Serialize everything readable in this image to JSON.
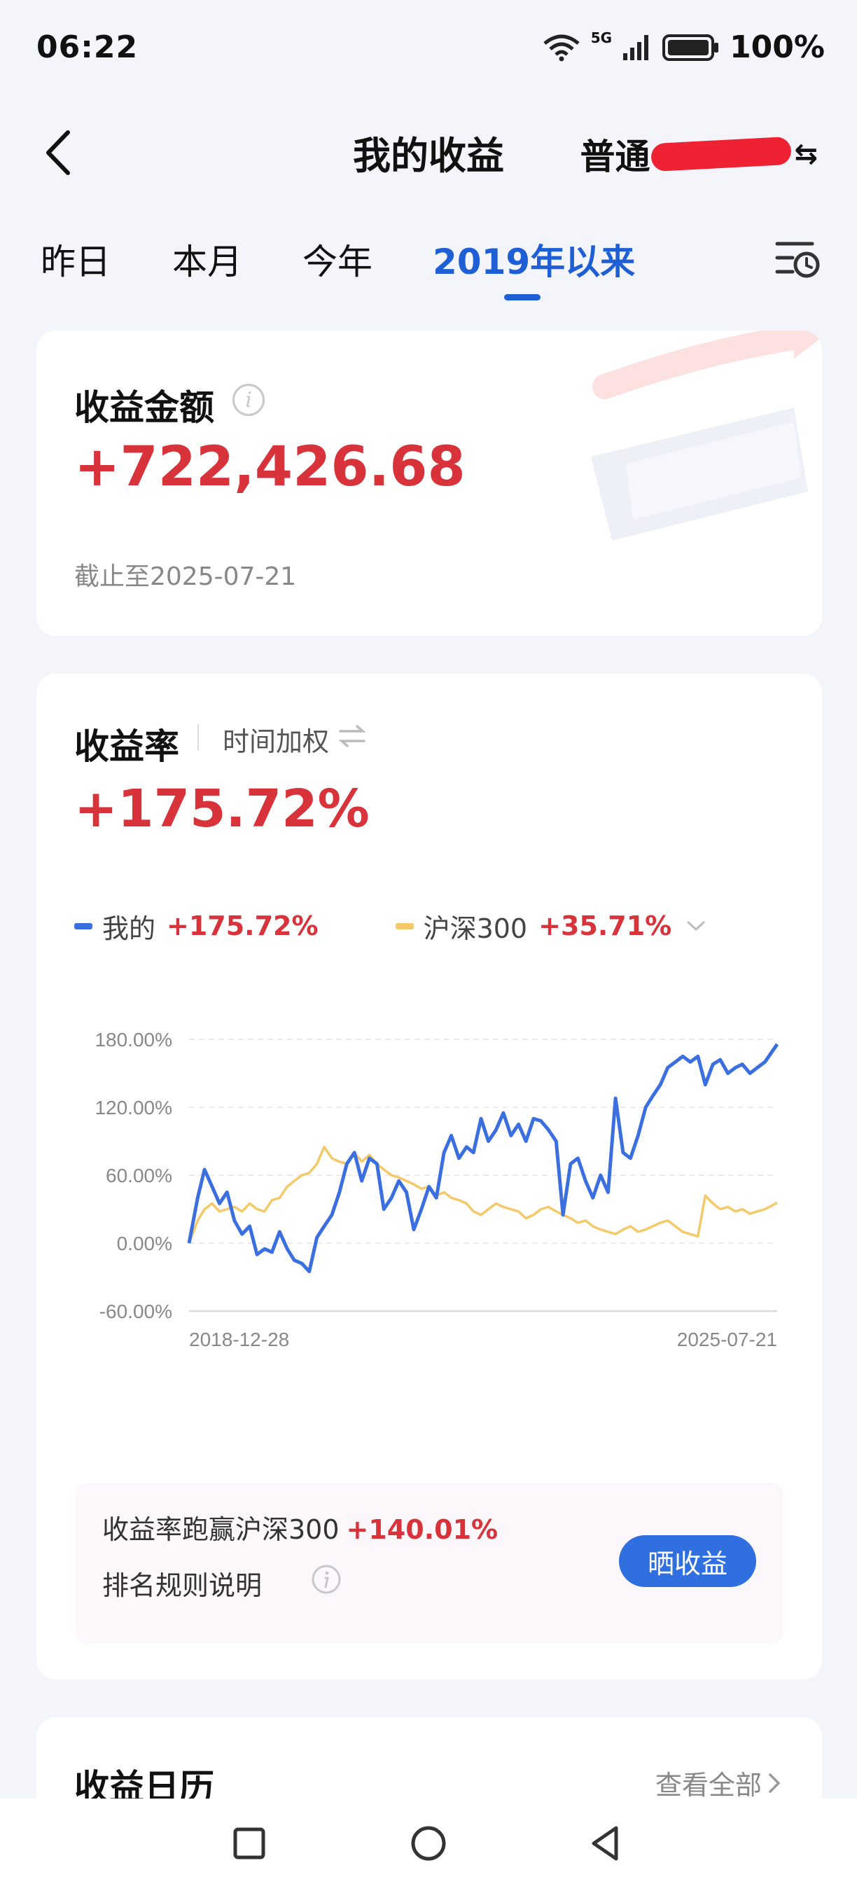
{
  "status_bar": {
    "time": "06:22",
    "network": "5G",
    "battery": "100%"
  },
  "header": {
    "title": "我的收益",
    "account_label": "普通"
  },
  "tabs": [
    {
      "label": "昨日",
      "active": false
    },
    {
      "label": "本月",
      "active": false
    },
    {
      "label": "今年",
      "active": false
    },
    {
      "label": "2019年以来",
      "active": true
    }
  ],
  "earnings": {
    "title": "收益金额",
    "amount": "+722,426.68",
    "as_of": "截止至2025-07-21"
  },
  "return_rate": {
    "title": "收益率",
    "method": "时间加权",
    "value": "+175.72%",
    "legend": [
      {
        "name": "我的",
        "value": "+175.72%",
        "color": "#3b6fe0"
      },
      {
        "name": "沪深300",
        "value": "+35.71%",
        "color": "#f3c969"
      }
    ]
  },
  "chart_data": {
    "type": "line",
    "x_start": "2018-12-28",
    "x_end": "2025-07-21",
    "x_tick_labels": [
      "2018-12-28",
      "2025-07-21"
    ],
    "y_tick_labels": [
      "180.00%",
      "120.00%",
      "60.00%",
      "0.00%",
      "-60.00%"
    ],
    "ylim": [
      -60,
      180
    ],
    "grid": true,
    "series": [
      {
        "name": "我的",
        "color": "#3b6fe0",
        "points": [
          [
            "2018-12-28",
            0
          ],
          [
            "2019-02-01",
            40
          ],
          [
            "2019-03-01",
            65
          ],
          [
            "2019-04-01",
            50
          ],
          [
            "2019-05-01",
            35
          ],
          [
            "2019-06-01",
            45
          ],
          [
            "2019-07-01",
            20
          ],
          [
            "2019-08-01",
            8
          ],
          [
            "2019-09-01",
            15
          ],
          [
            "2019-10-01",
            -10
          ],
          [
            "2019-11-01",
            -5
          ],
          [
            "2019-12-01",
            -8
          ],
          [
            "2020-01-01",
            10
          ],
          [
            "2020-02-01",
            -5
          ],
          [
            "2020-03-01",
            -15
          ],
          [
            "2020-04-01",
            -18
          ],
          [
            "2020-05-01",
            -25
          ],
          [
            "2020-06-01",
            5
          ],
          [
            "2020-07-01",
            15
          ],
          [
            "2020-08-01",
            25
          ],
          [
            "2020-09-01",
            45
          ],
          [
            "2020-10-01",
            70
          ],
          [
            "2020-11-01",
            80
          ],
          [
            "2020-12-01",
            55
          ],
          [
            "2021-01-01",
            75
          ],
          [
            "2021-02-01",
            70
          ],
          [
            "2021-03-01",
            30
          ],
          [
            "2021-04-01",
            40
          ],
          [
            "2021-05-01",
            55
          ],
          [
            "2021-06-01",
            45
          ],
          [
            "2021-07-01",
            12
          ],
          [
            "2021-08-01",
            30
          ],
          [
            "2021-09-01",
            50
          ],
          [
            "2021-10-01",
            40
          ],
          [
            "2021-11-01",
            80
          ],
          [
            "2021-12-01",
            95
          ],
          [
            "2022-01-01",
            75
          ],
          [
            "2022-02-01",
            85
          ],
          [
            "2022-03-01",
            80
          ],
          [
            "2022-04-01",
            110
          ],
          [
            "2022-05-01",
            90
          ],
          [
            "2022-06-01",
            100
          ],
          [
            "2022-07-01",
            115
          ],
          [
            "2022-08-01",
            95
          ],
          [
            "2022-09-01",
            105
          ],
          [
            "2022-10-01",
            90
          ],
          [
            "2022-11-01",
            110
          ],
          [
            "2022-12-01",
            108
          ],
          [
            "2023-01-01",
            100
          ],
          [
            "2023-02-01",
            90
          ],
          [
            "2023-03-01",
            25
          ],
          [
            "2023-04-01",
            70
          ],
          [
            "2023-05-01",
            75
          ],
          [
            "2023-06-01",
            55
          ],
          [
            "2023-07-01",
            40
          ],
          [
            "2023-08-01",
            60
          ],
          [
            "2023-09-01",
            45
          ],
          [
            "2023-10-01",
            128
          ],
          [
            "2023-11-01",
            80
          ],
          [
            "2023-12-01",
            75
          ],
          [
            "2024-01-01",
            95
          ],
          [
            "2024-02-01",
            120
          ],
          [
            "2024-03-01",
            130
          ],
          [
            "2024-04-01",
            140
          ],
          [
            "2024-05-01",
            155
          ],
          [
            "2024-06-01",
            160
          ],
          [
            "2024-07-01",
            165
          ],
          [
            "2024-08-01",
            160
          ],
          [
            "2024-09-01",
            165
          ],
          [
            "2024-10-01",
            140
          ],
          [
            "2024-11-01",
            158
          ],
          [
            "2024-12-01",
            162
          ],
          [
            "2025-01-01",
            150
          ],
          [
            "2025-02-01",
            155
          ],
          [
            "2025-03-01",
            158
          ],
          [
            "2025-04-01",
            150
          ],
          [
            "2025-05-01",
            155
          ],
          [
            "2025-06-01",
            160
          ],
          [
            "2025-07-21",
            175.72
          ]
        ]
      },
      {
        "name": "沪深300",
        "color": "#f3c969",
        "points": [
          [
            "2018-12-28",
            0
          ],
          [
            "2019-02-01",
            20
          ],
          [
            "2019-03-01",
            30
          ],
          [
            "2019-04-01",
            35
          ],
          [
            "2019-05-01",
            28
          ],
          [
            "2019-06-01",
            30
          ],
          [
            "2019-07-01",
            32
          ],
          [
            "2019-08-01",
            28
          ],
          [
            "2019-09-01",
            35
          ],
          [
            "2019-10-01",
            30
          ],
          [
            "2019-11-01",
            28
          ],
          [
            "2019-12-01",
            38
          ],
          [
            "2020-01-01",
            40
          ],
          [
            "2020-02-01",
            50
          ],
          [
            "2020-03-01",
            55
          ],
          [
            "2020-04-01",
            60
          ],
          [
            "2020-05-01",
            62
          ],
          [
            "2020-06-01",
            70
          ],
          [
            "2020-07-01",
            85
          ],
          [
            "2020-08-01",
            75
          ],
          [
            "2020-09-01",
            72
          ],
          [
            "2020-10-01",
            70
          ],
          [
            "2020-11-01",
            80
          ],
          [
            "2020-12-01",
            72
          ],
          [
            "2021-01-01",
            78
          ],
          [
            "2021-02-01",
            70
          ],
          [
            "2021-03-01",
            65
          ],
          [
            "2021-04-01",
            60
          ],
          [
            "2021-05-01",
            58
          ],
          [
            "2021-06-01",
            55
          ],
          [
            "2021-07-01",
            52
          ],
          [
            "2021-08-01",
            48
          ],
          [
            "2021-09-01",
            50
          ],
          [
            "2021-10-01",
            42
          ],
          [
            "2021-11-01",
            45
          ],
          [
            "2021-12-01",
            40
          ],
          [
            "2022-01-01",
            38
          ],
          [
            "2022-02-01",
            35
          ],
          [
            "2022-03-01",
            28
          ],
          [
            "2022-04-01",
            25
          ],
          [
            "2022-05-01",
            30
          ],
          [
            "2022-06-01",
            35
          ],
          [
            "2022-07-01",
            32
          ],
          [
            "2022-08-01",
            30
          ],
          [
            "2022-09-01",
            28
          ],
          [
            "2022-10-01",
            22
          ],
          [
            "2022-11-01",
            25
          ],
          [
            "2022-12-01",
            30
          ],
          [
            "2023-01-01",
            32
          ],
          [
            "2023-02-01",
            28
          ],
          [
            "2023-03-01",
            25
          ],
          [
            "2023-04-01",
            22
          ],
          [
            "2023-05-01",
            18
          ],
          [
            "2023-06-01",
            20
          ],
          [
            "2023-07-01",
            15
          ],
          [
            "2023-08-01",
            12
          ],
          [
            "2023-09-01",
            10
          ],
          [
            "2023-10-01",
            8
          ],
          [
            "2023-11-01",
            12
          ],
          [
            "2023-12-01",
            15
          ],
          [
            "2024-01-01",
            10
          ],
          [
            "2024-02-01",
            12
          ],
          [
            "2024-03-01",
            15
          ],
          [
            "2024-04-01",
            18
          ],
          [
            "2024-05-01",
            20
          ],
          [
            "2024-06-01",
            15
          ],
          [
            "2024-07-01",
            10
          ],
          [
            "2024-08-01",
            8
          ],
          [
            "2024-09-01",
            6
          ],
          [
            "2024-10-01",
            42
          ],
          [
            "2024-11-01",
            35
          ],
          [
            "2024-12-01",
            30
          ],
          [
            "2025-01-01",
            32
          ],
          [
            "2025-02-01",
            28
          ],
          [
            "2025-03-01",
            30
          ],
          [
            "2025-04-01",
            26
          ],
          [
            "2025-05-01",
            28
          ],
          [
            "2025-06-01",
            30
          ],
          [
            "2025-07-21",
            35.71
          ]
        ]
      }
    ]
  },
  "comparison": {
    "text": "收益率跑赢沪深300",
    "value": "+140.01%",
    "rules_label": "排名规则说明",
    "share_button": "晒收益"
  },
  "calendar": {
    "title": "收益日历",
    "view_all": "查看全部"
  }
}
